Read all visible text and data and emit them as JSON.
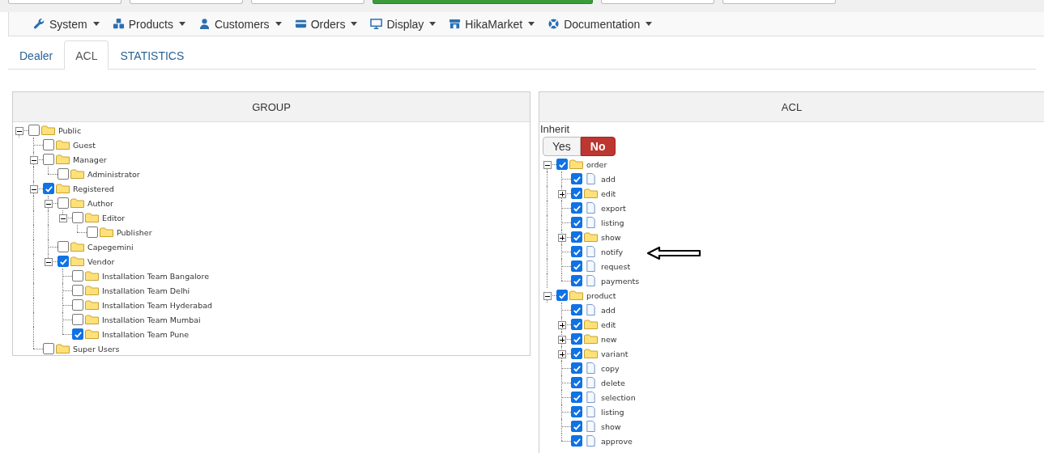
{
  "toolbar": {
    "buttons": [
      {
        "kind": "plain"
      },
      {
        "kind": "plain"
      },
      {
        "kind": "plain"
      },
      {
        "kind": "primary"
      },
      {
        "kind": "plain"
      },
      {
        "kind": "plain"
      }
    ]
  },
  "menu": [
    {
      "label": "System"
    },
    {
      "label": "Products"
    },
    {
      "label": "Customers"
    },
    {
      "label": "Orders"
    },
    {
      "label": "Display"
    },
    {
      "label": "HikaMarket"
    },
    {
      "label": "Documentation"
    }
  ],
  "tabs": [
    {
      "label": "Dealer",
      "selected": false
    },
    {
      "label": "ACL",
      "selected": true
    },
    {
      "label": "STATISTICS",
      "selected": false
    }
  ],
  "group_panel": {
    "title": "GROUP",
    "tree": [
      {
        "label": "Public",
        "kind": "folder",
        "checked": false,
        "expanded": true,
        "children": [
          {
            "label": "Guest",
            "kind": "folder",
            "checked": false
          },
          {
            "label": "Manager",
            "kind": "folder",
            "checked": false,
            "expanded": true,
            "children": [
              {
                "label": "Administrator",
                "kind": "folder",
                "checked": false
              }
            ]
          },
          {
            "label": "Registered",
            "kind": "folder",
            "checked": true,
            "expanded": true,
            "children": [
              {
                "label": "Author",
                "kind": "folder",
                "checked": false,
                "expanded": true,
                "children": [
                  {
                    "label": "Editor",
                    "kind": "folder",
                    "checked": false,
                    "expanded": true,
                    "children": [
                      {
                        "label": "Publisher",
                        "kind": "folder",
                        "checked": false
                      }
                    ]
                  }
                ]
              },
              {
                "label": "Capegemini",
                "kind": "folder",
                "checked": false
              },
              {
                "label": "Vendor",
                "kind": "folder",
                "checked": true,
                "expanded": true,
                "children": [
                  {
                    "label": "Installation Team Bangalore",
                    "kind": "folder",
                    "checked": false
                  },
                  {
                    "label": "Installation Team Delhi",
                    "kind": "folder",
                    "checked": false
                  },
                  {
                    "label": "Installation Team Hyderabad",
                    "kind": "folder",
                    "checked": false
                  },
                  {
                    "label": "Installation Team Mumbai",
                    "kind": "folder",
                    "checked": false
                  },
                  {
                    "label": "Installation Team Pune",
                    "kind": "folder",
                    "checked": true
                  }
                ]
              }
            ]
          },
          {
            "label": "Super Users",
            "kind": "folder",
            "checked": false
          }
        ]
      }
    ]
  },
  "acl_panel": {
    "title": "ACL",
    "inherit": {
      "label": "Inherit",
      "options": [
        {
          "label": "Yes",
          "selected": false
        },
        {
          "label": "No",
          "selected": true
        }
      ]
    },
    "tree": [
      {
        "label": "order",
        "kind": "folder",
        "checked": true,
        "expanded": true,
        "children": [
          {
            "label": "add",
            "kind": "file",
            "checked": true
          },
          {
            "label": "edit",
            "kind": "folder",
            "checked": true,
            "expanded": false
          },
          {
            "label": "export",
            "kind": "file",
            "checked": true
          },
          {
            "label": "listing",
            "kind": "file",
            "checked": true
          },
          {
            "label": "show",
            "kind": "folder",
            "checked": true,
            "expanded": false
          },
          {
            "label": "notify",
            "kind": "file",
            "checked": true
          },
          {
            "label": "request",
            "kind": "file",
            "checked": true
          },
          {
            "label": "payments",
            "kind": "file",
            "checked": true
          }
        ]
      },
      {
        "label": "product",
        "kind": "folder",
        "checked": true,
        "expanded": true,
        "children": [
          {
            "label": "add",
            "kind": "file",
            "checked": true
          },
          {
            "label": "edit",
            "kind": "folder",
            "checked": true,
            "expanded": false
          },
          {
            "label": "new",
            "kind": "folder",
            "checked": true,
            "expanded": false
          },
          {
            "label": "variant",
            "kind": "folder",
            "checked": true,
            "expanded": false
          },
          {
            "label": "copy",
            "kind": "file",
            "checked": true
          },
          {
            "label": "delete",
            "kind": "file",
            "checked": true
          },
          {
            "label": "selection",
            "kind": "file",
            "checked": true
          },
          {
            "label": "listing",
            "kind": "file",
            "checked": true
          },
          {
            "label": "show",
            "kind": "file",
            "checked": true
          },
          {
            "label": "approve",
            "kind": "file",
            "checked": true
          }
        ]
      }
    ]
  }
}
